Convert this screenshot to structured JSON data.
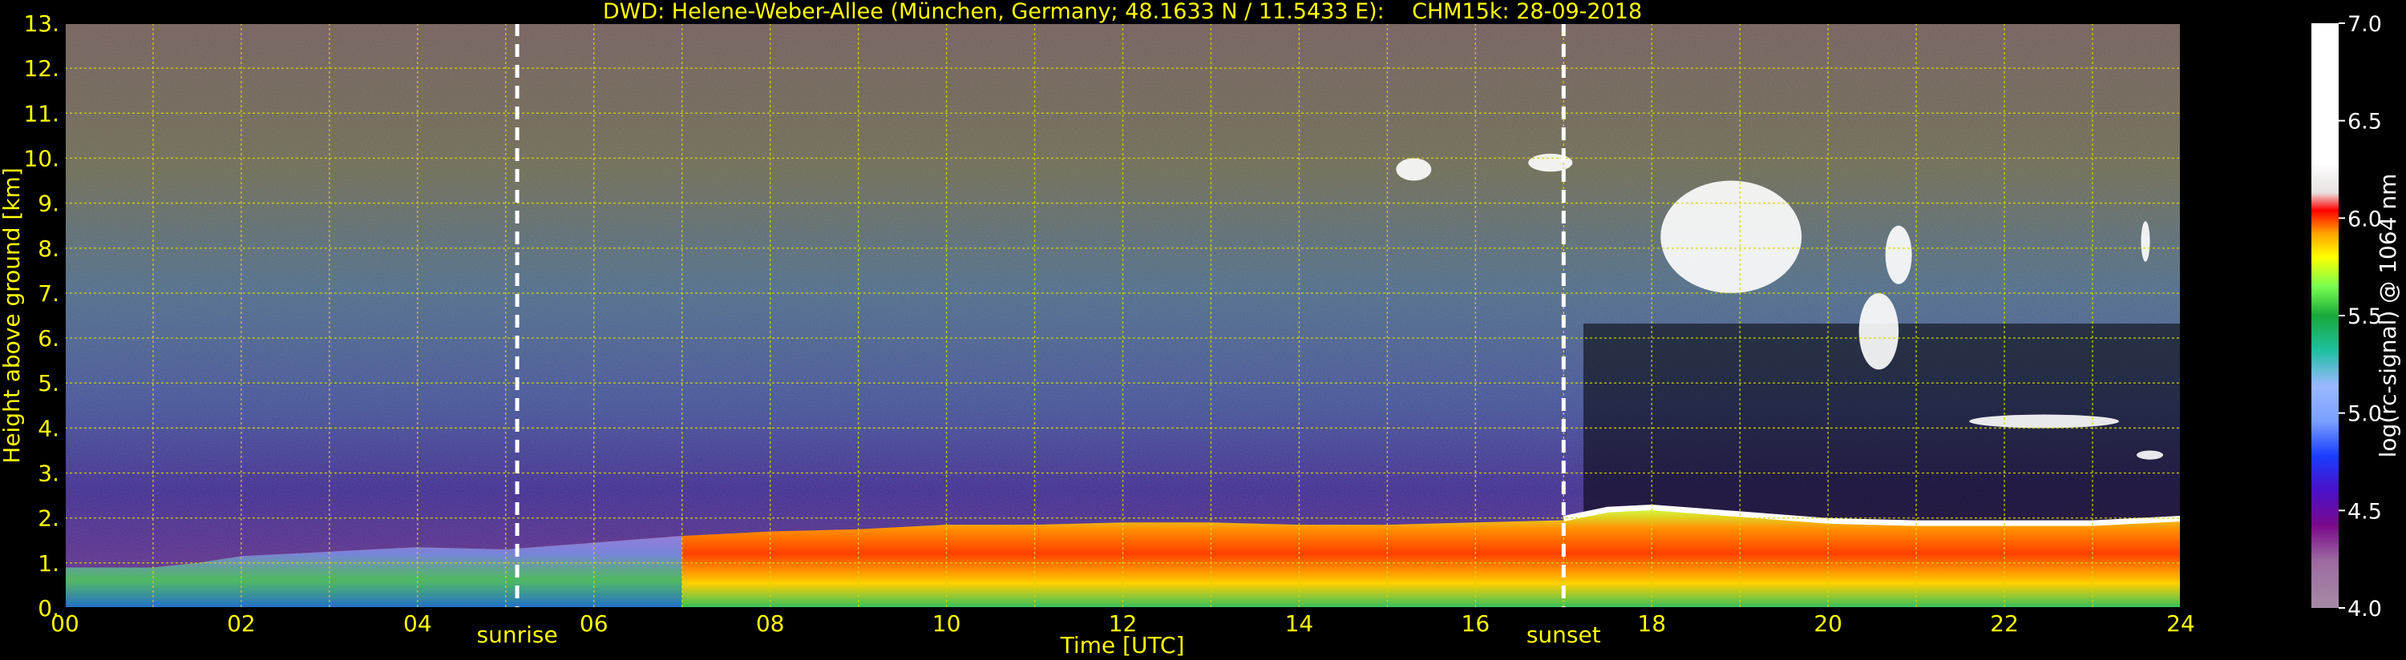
{
  "chart_data": {
    "type": "heatmap",
    "title": "DWD: Helene-Weber-Allee (München, Germany; 48.1633 N / 11.5433 E):    CHM15k: 28-09-2018",
    "xlabel": "Time [UTC]",
    "ylabel": "Height above ground [km]",
    "xlim": [
      0,
      24
    ],
    "ylim": [
      0,
      13
    ],
    "x_ticks": [
      "00",
      "02",
      "04",
      "06",
      "08",
      "10",
      "12",
      "14",
      "16",
      "18",
      "20",
      "22",
      "24"
    ],
    "y_ticks": [
      "0.",
      "1.",
      "2.",
      "3.",
      "4.",
      "5.",
      "6.",
      "7.",
      "8.",
      "9.",
      "10.",
      "11.",
      "12.",
      "13."
    ],
    "grid": true,
    "vlines": [
      {
        "x": 5.13,
        "label": "sunrise"
      },
      {
        "x": 17.0,
        "label": "sunset"
      }
    ],
    "colorbar": {
      "label": "log(rc-signal) @ 1064 nm",
      "range": [
        4.0,
        7.0
      ],
      "ticks": [
        "4.0",
        "4.5",
        "5.0",
        "5.5",
        "6.0",
        "6.5",
        "7.0"
      ]
    },
    "boundary_layer_top_km": [
      [
        0,
        0.9
      ],
      [
        1,
        0.9
      ],
      [
        1.5,
        1.0
      ],
      [
        2,
        1.15
      ],
      [
        3,
        1.25
      ],
      [
        4,
        1.35
      ],
      [
        5,
        1.3
      ],
      [
        6,
        1.45
      ],
      [
        7,
        1.6
      ],
      [
        8,
        1.7
      ],
      [
        9,
        1.75
      ],
      [
        10,
        1.85
      ],
      [
        11,
        1.85
      ],
      [
        12,
        1.9
      ],
      [
        13,
        1.9
      ],
      [
        14,
        1.85
      ],
      [
        15,
        1.85
      ],
      [
        16,
        1.9
      ],
      [
        17,
        1.95
      ],
      [
        17.5,
        2.15
      ],
      [
        18,
        2.2
      ],
      [
        19,
        2.05
      ],
      [
        20,
        1.9
      ],
      [
        21,
        1.85
      ],
      [
        22,
        1.85
      ],
      [
        23,
        1.85
      ],
      [
        24,
        1.95
      ]
    ],
    "cloud_features": [
      {
        "t0": 18.1,
        "t1": 19.7,
        "h0": 7.0,
        "h1": 9.5
      },
      {
        "t0": 20.35,
        "t1": 20.8,
        "h0": 5.3,
        "h1": 7.0
      },
      {
        "t0": 20.65,
        "t1": 20.95,
        "h0": 7.2,
        "h1": 8.5
      },
      {
        "t0": 21.6,
        "t1": 23.3,
        "h0": 4.0,
        "h1": 4.3
      },
      {
        "t0": 23.5,
        "t1": 23.8,
        "h0": 3.3,
        "h1": 3.5
      },
      {
        "t0": 23.55,
        "t1": 23.65,
        "h0": 7.7,
        "h1": 8.6
      },
      {
        "t0": 15.1,
        "t1": 15.5,
        "h0": 9.5,
        "h1": 10.0
      },
      {
        "t0": 16.6,
        "t1": 17.1,
        "h0": 9.7,
        "h1": 10.1
      }
    ]
  }
}
